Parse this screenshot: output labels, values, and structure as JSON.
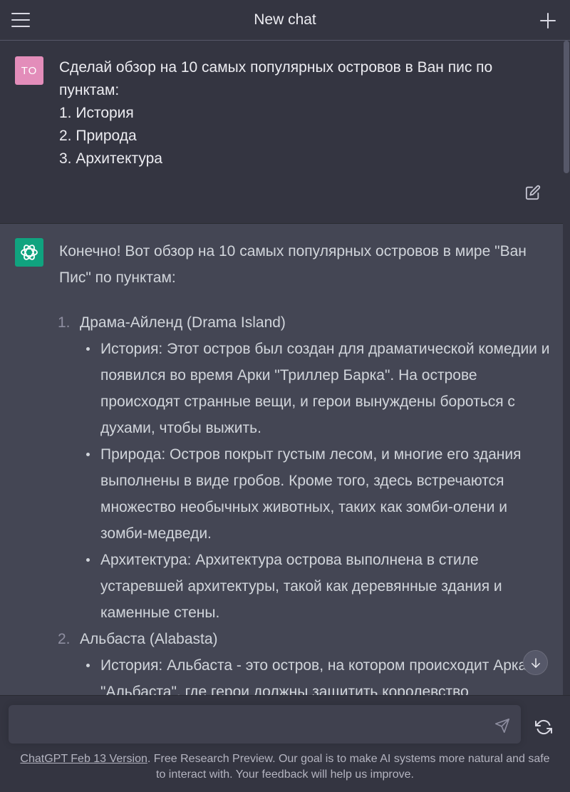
{
  "header": {
    "title": "New chat"
  },
  "user_message": {
    "avatar_initials": "TO",
    "lines": [
      "Сделай обзор на 10 самых популярных островов в Ван пис по",
      "пунктам:",
      "1. История",
      "2. Природа",
      "3. Архитектура"
    ]
  },
  "assistant_message": {
    "intro": "Конечно! Вот обзор на 10 самых популярных островов в мире \"Ван Пис\" по пунктам:",
    "islands": [
      {
        "number": "1.",
        "name": "Драма-Айленд (Drama Island)",
        "bullets": [
          "История: Этот остров был создан для драматической комедии и появился во время Арки \"Триллер Барка\". На острове происходят странные вещи, и герои вынуждены бороться с духами, чтобы выжить.",
          "Природа: Остров покрыт густым лесом, и многие его здания выполнены в виде гробов. Кроме того, здесь встречаются множество необычных животных, таких как зомби-олени и зомби-медведи.",
          "Архитектура: Архитектура острова выполнена в стиле устаревшей архитектуры, такой как деревянные здания и каменные стены."
        ]
      },
      {
        "number": "2.",
        "name": "Альбаста (Alabasta)",
        "bullets": [
          "История: Альбаста - это остров, на котором происходит Арка \"Альбаста\", где герои должны защитить королевство"
        ]
      }
    ]
  },
  "composer": {
    "placeholder": ""
  },
  "footer": {
    "version_link": "ChatGPT Feb 13 Version",
    "text": ". Free Research Preview. Our goal is to make AI systems more natural and safe to interact with. Your feedback will help us improve."
  },
  "colors": {
    "background": "#343541",
    "assistant_bg": "#444654",
    "user_avatar": "#e38dba",
    "assistant_avatar": "#10a37f"
  },
  "icons": {
    "menu": "hamburger-menu-icon",
    "new_chat": "plus-icon",
    "edit": "edit-icon",
    "assistant_logo": "openai-logo-icon",
    "scroll_down": "arrow-down-icon",
    "send": "paper-plane-icon",
    "regenerate": "refresh-icon"
  }
}
